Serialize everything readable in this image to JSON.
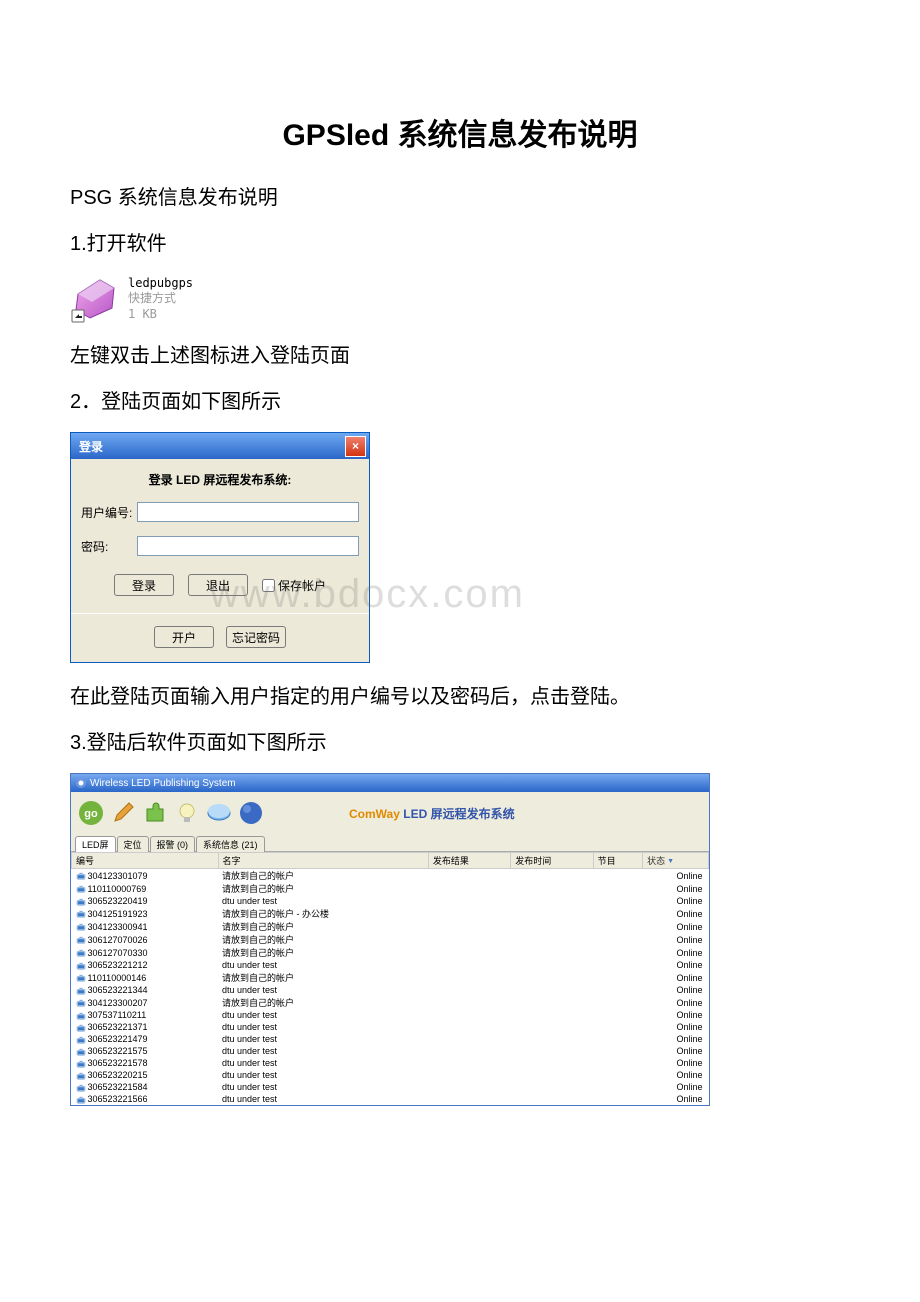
{
  "doc": {
    "title": "GPSled 系统信息发布说明",
    "line1": "PSG 系统信息发布说明",
    "line2": "1.打开软件",
    "line3": "左键双击上述图标进入登陆页面",
    "line4": "2．登陆页面如下图所示",
    "line5": "在此登陆页面输入用户指定的用户编号以及密码后，点击登陆。",
    "line6": "3.登陆后软件页面如下图所示"
  },
  "shortcut": {
    "filename": "ledpubgps",
    "type": "快捷方式",
    "size": "1 KB"
  },
  "login": {
    "title": "登录",
    "close": "×",
    "subtitle": "登录 LED 屏远程发布系统:",
    "user_label": "用户编号:",
    "user_value": "",
    "pass_label": "密码:",
    "pass_value": "",
    "btn_login": "登录",
    "btn_exit": "退出",
    "chk_save": "保存帐户",
    "btn_open": "开户",
    "btn_forgot": "忘记密码"
  },
  "watermark": "www.bdocx.com",
  "app": {
    "window_title": "Wireless LED Publishing System",
    "brand_prefix": "ComWay",
    "brand_suffix": " LED 屏远程发布系统",
    "tabs": [
      "LED屏",
      "定位",
      "报警 (0)",
      "系统信息 (21)"
    ],
    "columns": [
      "编号",
      "名字",
      "发布结果",
      "发布时间",
      "节目",
      "状态"
    ],
    "rows": [
      {
        "id": "304123301079",
        "name": "请放到自己的帐户",
        "status": "Online"
      },
      {
        "id": "110110000769",
        "name": "请放到自己的帐户",
        "status": "Online"
      },
      {
        "id": "306523220419",
        "name": "dtu under test",
        "status": "Online"
      },
      {
        "id": "304125191923",
        "name": "请放到自己的帐户 - 办公楼",
        "status": "Online"
      },
      {
        "id": "304123300941",
        "name": "请放到自己的帐户",
        "status": "Online"
      },
      {
        "id": "306127070026",
        "name": "请放到自己的帐户",
        "status": "Online"
      },
      {
        "id": "306127070330",
        "name": "请放到自己的帐户",
        "status": "Online"
      },
      {
        "id": "306523221212",
        "name": "dtu under test",
        "status": "Online"
      },
      {
        "id": "110110000146",
        "name": "请放到自己的帐户",
        "status": "Online"
      },
      {
        "id": "306523221344",
        "name": "dtu under test",
        "status": "Online"
      },
      {
        "id": "304123300207",
        "name": "请放到自己的帐户",
        "status": "Online"
      },
      {
        "id": "307537110211",
        "name": "dtu under test",
        "status": "Online"
      },
      {
        "id": "306523221371",
        "name": "dtu under test",
        "status": "Online"
      },
      {
        "id": "306523221479",
        "name": "dtu under test",
        "status": "Online"
      },
      {
        "id": "306523221575",
        "name": "dtu under test",
        "status": "Online"
      },
      {
        "id": "306523221578",
        "name": "dtu under test",
        "status": "Online"
      },
      {
        "id": "306523220215",
        "name": "dtu under test",
        "status": "Online"
      },
      {
        "id": "306523221584",
        "name": "dtu under test",
        "status": "Online"
      },
      {
        "id": "306523221566",
        "name": "dtu under test",
        "status": "Online"
      }
    ]
  }
}
